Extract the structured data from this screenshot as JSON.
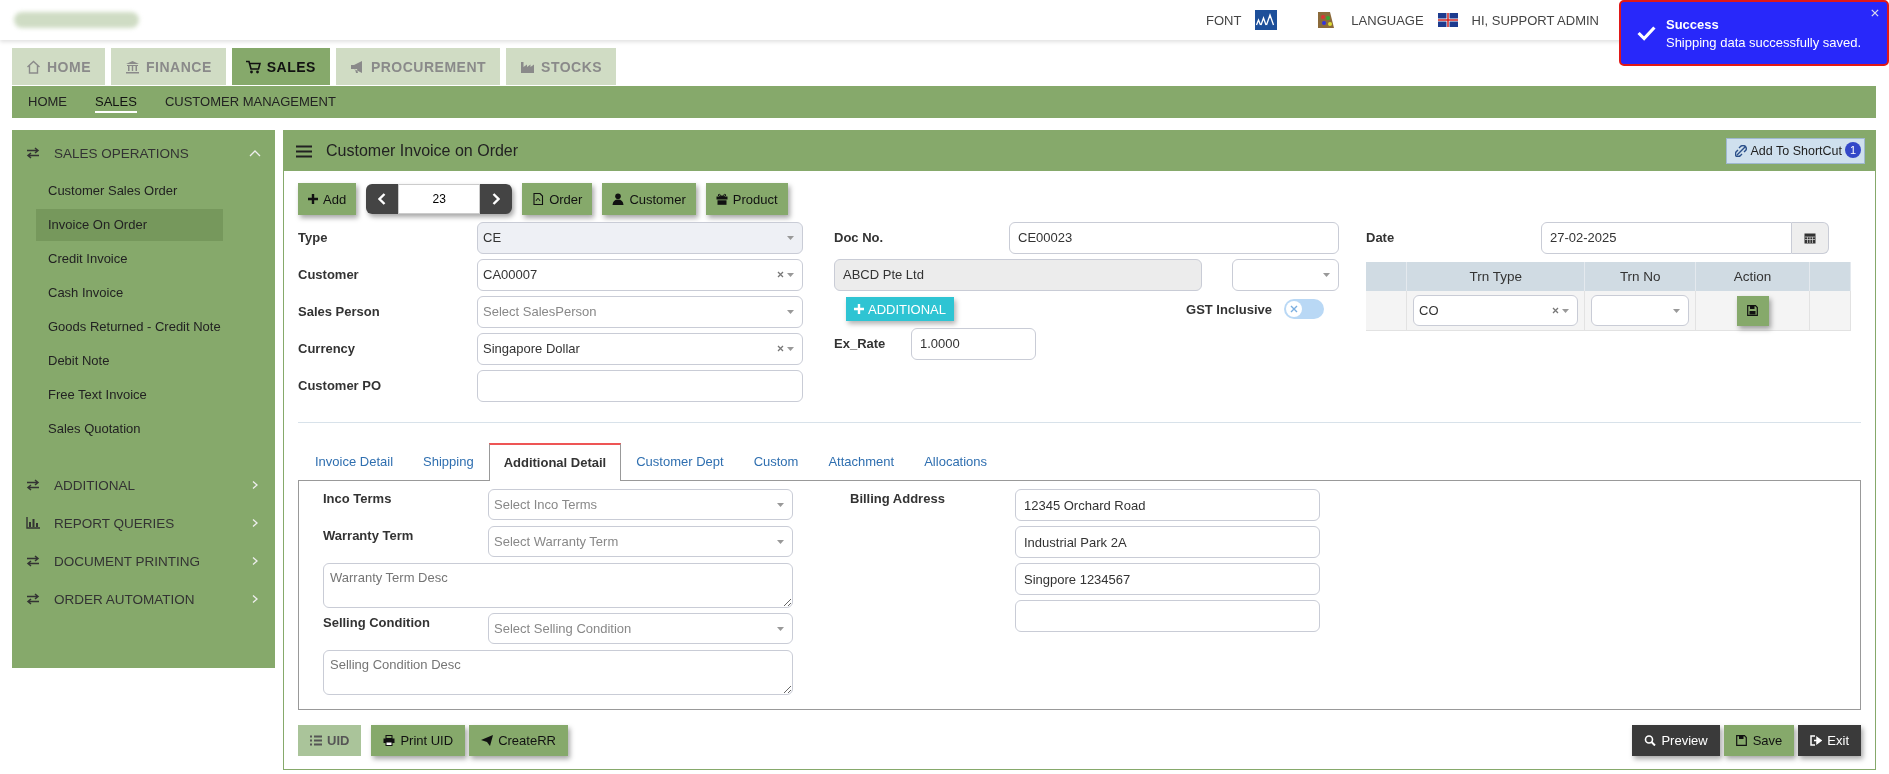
{
  "header": {
    "font_label": "FONT",
    "language_label": "LANGUAGE",
    "user": "HI, SUPPORT ADMIN"
  },
  "toast": {
    "title": "Success",
    "message": "Shipping data successfully saved."
  },
  "main_tabs": [
    {
      "label": "HOME",
      "selected": false
    },
    {
      "label": "FINANCE",
      "selected": false
    },
    {
      "label": "SALES",
      "selected": true
    },
    {
      "label": "PROCUREMENT",
      "selected": false
    },
    {
      "label": "STOCKS",
      "selected": false
    }
  ],
  "sub_nav": [
    {
      "label": "HOME",
      "selected": false
    },
    {
      "label": "SALES",
      "selected": true
    },
    {
      "label": "CUSTOMER MANAGEMENT",
      "selected": false
    }
  ],
  "sidebar": {
    "sections": [
      {
        "label": "SALES OPERATIONS",
        "expanded": true,
        "children": [
          {
            "label": "Customer Sales Order",
            "selected": false
          },
          {
            "label": "Invoice On Order",
            "selected": true
          },
          {
            "label": "Credit Invoice",
            "selected": false
          },
          {
            "label": "Cash Invoice",
            "selected": false
          },
          {
            "label": "Goods Returned - Credit Note",
            "selected": false
          },
          {
            "label": "Debit Note",
            "selected": false
          },
          {
            "label": "Free Text Invoice",
            "selected": false
          },
          {
            "label": "Sales Quotation",
            "selected": false
          }
        ]
      },
      {
        "label": "ADDITIONAL",
        "expanded": false
      },
      {
        "label": "REPORT QUERIES",
        "expanded": false
      },
      {
        "label": "DOCUMENT PRINTING",
        "expanded": false
      },
      {
        "label": "ORDER AUTOMATION",
        "expanded": false
      }
    ]
  },
  "panel": {
    "title": "Customer Invoice on Order",
    "shortcut": "Add To ShortCut",
    "shortcut_count": "1"
  },
  "toolbar": {
    "add": "Add",
    "record_no": "23",
    "buttons": [
      "Order",
      "Customer",
      "Product"
    ]
  },
  "form": {
    "left": [
      {
        "label": "Type",
        "kind": "select",
        "value": "CE",
        "disabled": true
      },
      {
        "label": "Customer",
        "kind": "select",
        "value": "CA00007",
        "disabled": false
      },
      {
        "label": "Sales Person",
        "kind": "select",
        "placeholder": "Select SalesPerson",
        "disabled": false
      },
      {
        "label": "Currency",
        "kind": "select",
        "value": "Singapore Dollar",
        "disabled": false
      },
      {
        "label": "Customer PO",
        "kind": "input",
        "disabled": false
      }
    ],
    "doc_no": {
      "label": "Doc No.",
      "value": "CE00023"
    },
    "customer_name": {
      "value": "ABCD Pte Ltd"
    },
    "additional_button": "ADDITIONAL",
    "gst": {
      "label": "GST Inclusive",
      "on": false
    },
    "ex_rate": {
      "label": "Ex_Rate",
      "value": "1.0000"
    },
    "date": {
      "label": "Date",
      "value": "27-02-2025"
    },
    "trn_table": {
      "columns": [
        "Trn Type",
        "Trn No",
        "Action"
      ],
      "rows": [
        {
          "trn_type": "CO"
        }
      ]
    }
  },
  "detail_tabs": [
    {
      "label": "Invoice Detail",
      "selected": false
    },
    {
      "label": "Shipping",
      "selected": false
    },
    {
      "label": "Additional Detail",
      "selected": true
    },
    {
      "label": "Customer Dept",
      "selected": false
    },
    {
      "label": "Custom",
      "selected": false
    },
    {
      "label": "Attachment",
      "selected": false
    },
    {
      "label": "Allocations",
      "selected": false
    }
  ],
  "additional_detail": {
    "fields": [
      {
        "kind": "select",
        "label": "Inco Terms",
        "placeholder": "Select Inco Terms"
      },
      {
        "kind": "select",
        "label": "Warranty Term",
        "placeholder": "Select Warranty Term"
      },
      {
        "kind": "textarea",
        "placeholder": "Warranty Term Desc"
      },
      {
        "kind": "select",
        "label": "Selling Condition",
        "placeholder": "Select Selling Condition"
      },
      {
        "kind": "textarea",
        "placeholder": "Selling Condition Desc"
      }
    ],
    "billing_label": "Billing Address",
    "billing_lines": [
      "12345 Orchard Road",
      "Industrial Park 2A",
      "Singpore 1234567"
    ]
  },
  "footer": {
    "left": [
      {
        "label": "UID",
        "kind": "muted"
      },
      {
        "label": "Print UID",
        "kind": "primary"
      },
      {
        "label": "CreateRR",
        "kind": "primary"
      }
    ],
    "right": [
      {
        "label": "Preview",
        "kind": "dark"
      },
      {
        "label": "Save",
        "kind": "primary"
      },
      {
        "label": "Exit",
        "kind": "dark"
      }
    ]
  }
}
